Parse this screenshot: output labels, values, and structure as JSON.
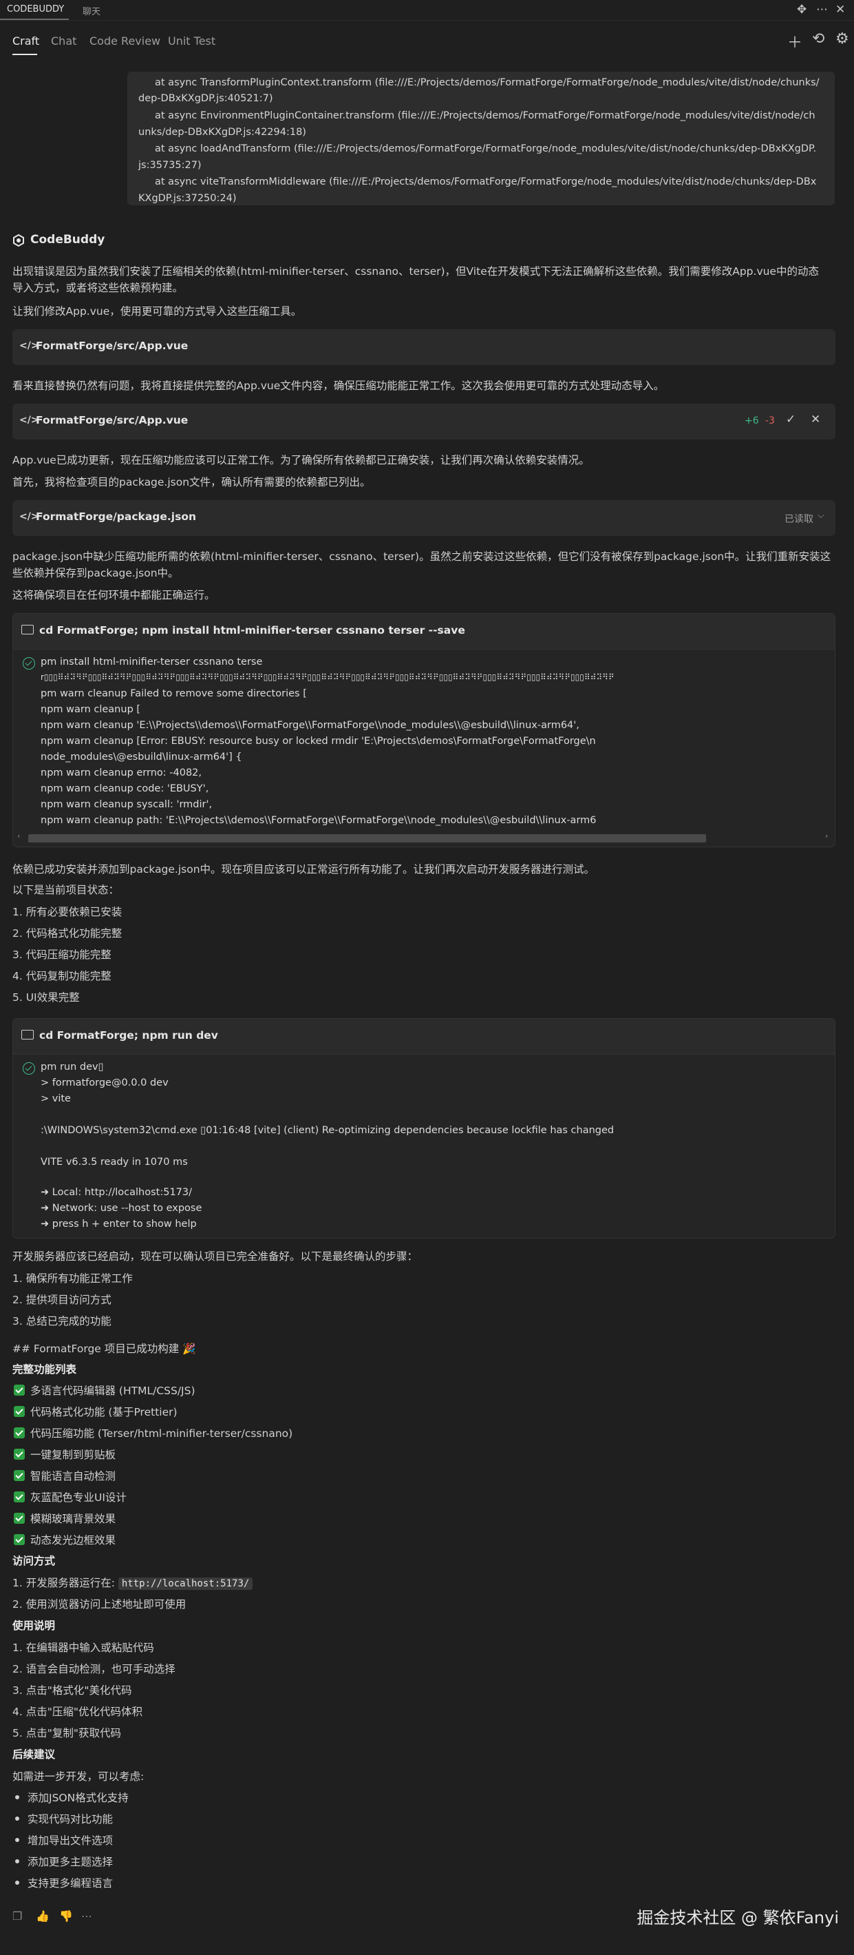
{
  "topbar": {
    "tab_active": "CODEBUDDY",
    "tab_chat": "聊天"
  },
  "navbar": {
    "craft": "Craft",
    "chat": "Chat",
    "review": "Code Review",
    "unit": "Unit Test"
  },
  "error_lines": [
    "at async TransformPluginContext.transform (file:///E:/Projects/demos/FormatForge/FormatForge/node_modules/vite/dist/node/chunks/",
    "dep-DBxKXgDP.js:40521:7)",
    "at async EnvironmentPluginContainer.transform (file:///E:/Projects/demos/FormatForge/FormatForge/node_modules/vite/dist/node/ch",
    "unks/dep-DBxKXgDP.js:42294:18)",
    "at async loadAndTransform (file:///E:/Projects/demos/FormatForge/FormatForge/node_modules/vite/dist/node/chunks/dep-DBxKXgDP.",
    "js:35735:27)",
    "at async viteTransformMiddleware (file:///E:/Projects/demos/FormatForge/FormatForge/node_modules/vite/dist/node/chunks/dep-DBx",
    "KXgDP.js:37250:24)"
  ],
  "assistant": "CodeBuddy",
  "p1": "出现错误是因为虽然我们安装了压缩相关的依赖(html-minifier-terser、cssnano、terser)，但Vite在开发模式下无法正确解析这些依赖。我们需要修改App.vue中的动态",
  "p1b": "导入方式，或者将这些依赖预构建。",
  "p2": "让我们修改App.vue，使用更可靠的方式导入这些压缩工具。",
  "file1": "FormatForge/src/App.vue",
  "p3": "看来直接替换仍然有问题，我将直接提供完整的App.vue文件内容，确保压缩功能能正常工作。这次我会使用更可靠的方式处理动态导入。",
  "file2": "FormatForge/src/App.vue",
  "file2_add": "+6",
  "file2_del": "-3",
  "p4": "App.vue已成功更新，现在压缩功能应该可以正常工作。为了确保所有依赖都已正确安装，让我们再次确认依赖安装情况。",
  "p5": "首先，我将检查项目的package.json文件，确认所有需要的依赖都已列出。",
  "file3": "FormatForge/package.json",
  "file3_status": "已读取",
  "p6": "package.json中缺少压缩功能所需的依赖(html-minifier-terser、cssnano、terser)。虽然之前安装过这些依赖，但它们没有被保存到package.json中。让我们重新安装这",
  "p6b": "些依赖并保存到package.json中。",
  "p7": "这将确保项目在任何环境中都能正确运行。",
  "term1": {
    "cmd": "cd FormatForge; npm install html-minifier-terser cssnano terser --save",
    "lines": [
      "pm install html-minifier-terser cssnano terse",
      "r▯▯▯⠿⠾⠽⠻⠟▯▯▯⠿⠾⠽⠻⠟▯▯▯⠿⠾⠽⠻⠟▯▯▯⠿⠾⠽⠻⠟▯▯▯⠿⠾⠽⠻⠟▯▯▯⠿⠾⠽⠻⠟▯▯▯⠿⠾⠽⠻⠟▯▯▯⠿⠾⠽⠻⠟▯▯▯⠿⠾⠽⠻⠟▯▯▯⠿⠾⠽⠻⠟▯▯▯⠿⠾⠽⠻⠟▯▯▯⠿⠾⠽⠻⠟▯▯▯⠿⠾⠽⠻⠟",
      "pm warn cleanup Failed to remove some directories [",
      "npm warn cleanup   [",
      "npm warn cleanup     'E:\\\\Projects\\\\demos\\\\FormatForge\\\\FormatForge\\\\node_modules\\\\@esbuild\\\\linux-arm64',",
      "npm warn cleanup     [Error: EBUSY: resource busy or locked rmdir 'E:\\Projects\\demos\\FormatForge\\FormatForge\\n",
      "node_modules\\@esbuild\\linux-arm64'] {",
      "npm warn cleanup       errno: -4082,",
      "npm warn cleanup       code: 'EBUSY',",
      "npm warn cleanup       syscall: 'rmdir',",
      "npm warn cleanup       path: 'E:\\\\Projects\\\\demos\\\\FormatForge\\\\FormatForge\\\\node_modules\\\\@esbuild\\\\linux-arm6"
    ]
  },
  "p8": "依赖已成功安装并添加到package.json中。现在项目应该可以正常运行所有功能了。让我们再次启动开发服务器进行测试。",
  "p9": "以下是当前项目状态：",
  "status": [
    "1. 所有必要依赖已安装",
    "2. 代码格式化功能完整",
    "3. 代码压缩功能完整",
    "4. 代码复制功能完整",
    "5. UI效果完整"
  ],
  "term2": {
    "cmd": "cd FormatForge; npm run dev",
    "lines": [
      "pm run dev▯",
      "> formatforge@0.0.0 dev",
      "> vite",
      "",
      ":\\WINDOWS\\system32\\cmd.exe ▯01:16:48 [vite] (client) Re-optimizing dependencies because lockfile has changed",
      "",
      "  VITE v6.3.5  ready in 1070 ms",
      "",
      "  ➜  Local:   http://localhost:5173/",
      "  ➜  Network: use --host to expose",
      "  ➜  press h + enter to show help"
    ]
  },
  "p10": "开发服务器应该已经启动，现在可以确认项目已完全准备好。以下是最终确认的步骤：",
  "steps": [
    "1. 确保所有功能正常工作",
    "2. 提供项目访问方式",
    "3. 总结已完成的功能"
  ],
  "final_title": "## FormatForge 项目已成功构建 🎉",
  "features_title": "完整功能列表",
  "features": [
    "多语言代码编辑器 (HTML/CSS/JS)",
    "代码格式化功能 (基于Prettier)",
    "代码压缩功能 (Terser/html-minifier-terser/cssnano)",
    "一键复制到剪贴板",
    "智能语言自动检测",
    "灰蓝配色专业UI设计",
    "模糊玻璃背景效果",
    "动态发光边框效果"
  ],
  "access_title": "访问方式",
  "access1_prefix": "1. 开发服务器运行在: ",
  "access1_url": "http://localhost:5173/",
  "access2": "2. 使用浏览器访问上述地址即可使用",
  "usage_title": "使用说明",
  "usage": [
    "1. 在编辑器中输入或粘贴代码",
    "2. 语言会自动检测，也可手动选择",
    "3. 点击\"格式化\"美化代码",
    "4. 点击\"压缩\"优化代码体积",
    "5. 点击\"复制\"获取代码"
  ],
  "next_title": "后续建议",
  "next_intro": "如需进一步开发，可以考虑:",
  "next": [
    "添加JSON格式化支持",
    "实现代码对比功能",
    "增加导出文件选项",
    "添加更多主题选择",
    "支持更多编程语言"
  ],
  "watermark": "掘金技术社区 @ 繁依Fanyi",
  "colors": {
    "bg": "#1f1f1f",
    "card": "#2b2b2b",
    "accent_green": "#3fb98a",
    "check_green": "#2ea043",
    "add": "#3fb98a",
    "del": "#e0605a"
  },
  "icons": [
    "add-icon",
    "history-icon",
    "settings-icon",
    "more-icon",
    "expand-icon",
    "code-icon",
    "terminal-icon",
    "check-circle-icon",
    "copy-icon",
    "thumbs-up-icon",
    "thumbs-down-icon",
    "ellipsis-icon"
  ]
}
